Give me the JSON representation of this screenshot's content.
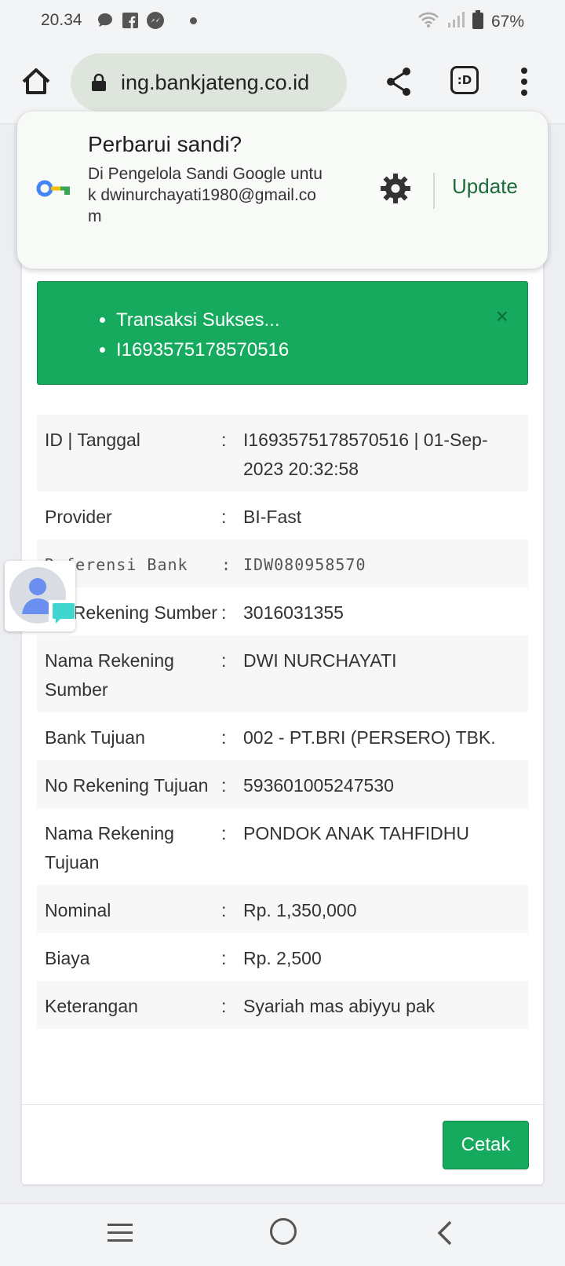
{
  "status_bar": {
    "time": "20.34",
    "battery": "67%",
    "icons": [
      "message-icon",
      "facebook-icon",
      "messenger-icon",
      "wifi-icon",
      "signal-icon",
      "battery-icon"
    ]
  },
  "browser": {
    "url": "ing.bankjateng.co.id",
    "tab_label": ":D",
    "icons": [
      "home-icon",
      "lock-icon",
      "share-icon",
      "menu-icon"
    ]
  },
  "password_prompt": {
    "title": "Perbarui sandi?",
    "description": "Di Pengelola Sandi Google untuk dwinurchayati1980@gmail.com",
    "update_label": "Update"
  },
  "alert": {
    "items": [
      "Transaksi Sukses...",
      "I1693575178570516"
    ],
    "close": "×",
    "color": "#16aa5e"
  },
  "details": {
    "rows": [
      {
        "label": "ID | Tanggal",
        "colon": ":",
        "value": "I1693575178570516 | 01-Sep-2023 20:32:58"
      },
      {
        "label": "Provider",
        "colon": ":",
        "value": "BI-Fast"
      },
      {
        "label": "Referensi Bank",
        "colon": ":",
        "value": "IDW080958570"
      },
      {
        "label": "No Rekening Sumber",
        "colon": ":",
        "value": "3016031355"
      },
      {
        "label": "Nama Rekening Sumber",
        "colon": ":",
        "value": "DWI NURCHAYATI"
      },
      {
        "label": "Bank Tujuan",
        "colon": ":",
        "value": "002 - PT.BRI (PERSERO) TBK."
      },
      {
        "label": "No Rekening Tujuan",
        "colon": ":",
        "value": "593601005247530"
      },
      {
        "label": "Nama Rekening Tujuan",
        "colon": ":",
        "value": "PONDOK ANAK TAHFIDHU"
      },
      {
        "label": "Nominal",
        "colon": ":",
        "value": "Rp. 1,350,000"
      },
      {
        "label": "Biaya",
        "colon": ":",
        "value": "Rp. 2,500"
      },
      {
        "label": "Keterangan",
        "colon": ":",
        "value": "Syariah mas abiyyu pak"
      }
    ]
  },
  "actions": {
    "print_label": "Cetak"
  }
}
